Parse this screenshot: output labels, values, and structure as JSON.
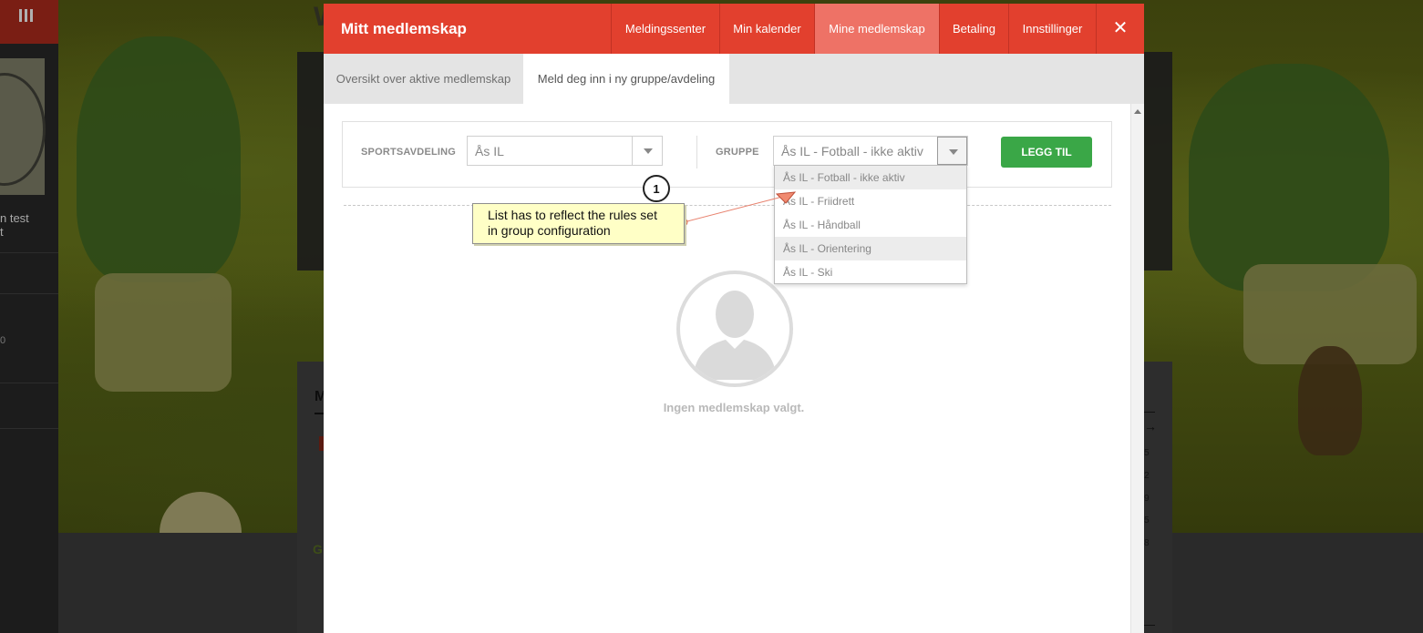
{
  "background": {
    "side_text": "n test\nt",
    "side_number": "0",
    "lower_heading": "M",
    "lower_letter": "G",
    "right_numbers": [
      "5",
      "2",
      "9",
      "5",
      "8"
    ]
  },
  "modal": {
    "title": "Mitt medlemskap",
    "nav": [
      "Meldingssenter",
      "Min kalender",
      "Mine medlemskap",
      "Betaling",
      "Innstillinger"
    ],
    "active_nav": "Mine medlemskap",
    "close_icon": "close-icon",
    "subtabs": [
      "Oversikt over aktive medlemskap",
      "Meld deg inn i ny gruppe/avdeling"
    ],
    "active_subtab": "Meld deg inn i ny gruppe/avdeling"
  },
  "form": {
    "sportsavdeling_label": "SPORTSAVDELING",
    "sportsavdeling_value": "Ås IL",
    "gruppe_label": "GRUPPE",
    "gruppe_value": "Ås IL - Fotball - ikke aktiv",
    "add_button": "LEGG TIL",
    "add_button_color": "#3aa747"
  },
  "dropdown_options": [
    "Ås IL - Fotball - ikke aktiv",
    "Ås IL - Friidrett",
    "Ås IL - Håndball",
    "Ås IL - Orientering",
    "Ås IL - Ski"
  ],
  "empty_state": {
    "icon": "user-placeholder-icon",
    "text": "Ingen medlemskap valgt."
  },
  "annotation": {
    "number": "1",
    "line1": "List has to reflect the rules set",
    "line2": "in group configuration"
  },
  "colors": {
    "header": "#e2402e",
    "active_tab": "#ee7266",
    "callout_bg": "#ffffc6"
  }
}
